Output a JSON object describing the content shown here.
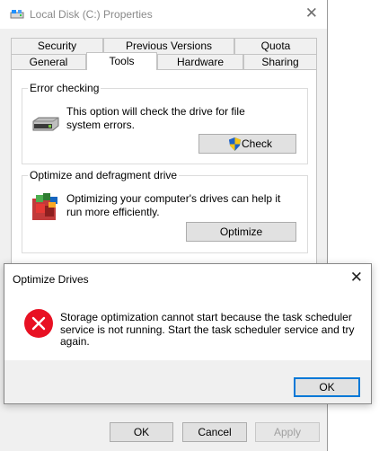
{
  "properties": {
    "title": "Local Disk (C:) Properties",
    "tabs_row1": [
      "Security",
      "Previous Versions",
      "Quota"
    ],
    "tabs_row2": [
      "General",
      "Tools",
      "Hardware",
      "Sharing"
    ],
    "error_checking": {
      "title": "Error checking",
      "description": "This option will check the drive for file system errors.",
      "button": "Check"
    },
    "optimize": {
      "title": "Optimize and defragment drive",
      "description": "Optimizing your computer's drives can help it run more efficiently.",
      "button": "Optimize"
    },
    "buttons": {
      "ok": "OK",
      "cancel": "Cancel",
      "apply": "Apply"
    }
  },
  "dialog": {
    "title": "Optimize Drives",
    "message": "Storage optimization cannot start because the task scheduler service is not running. Start the task scheduler service and try again.",
    "ok": "OK"
  },
  "icons": {
    "title": "drive-icon",
    "close": "close-icon",
    "error_checking": "hard-drive-icon",
    "check_button": "uac-shield-icon",
    "optimize": "defragment-icon",
    "dialog_error": "error-icon"
  },
  "colors": {
    "accent": "#0078d7",
    "error": "#e81123"
  }
}
